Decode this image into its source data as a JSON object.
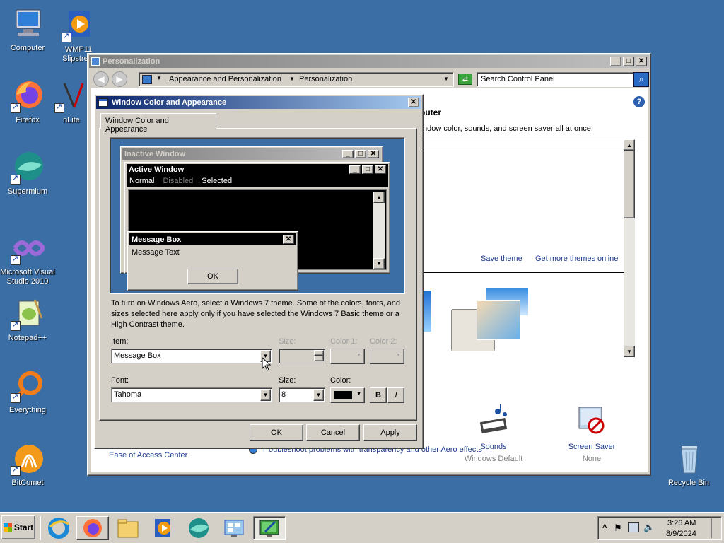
{
  "desktop": {
    "icons": [
      {
        "label": "Computer",
        "icon": "computer-icon"
      },
      {
        "label": "WMP11 Slipstre...",
        "icon": "wmp-icon"
      },
      {
        "label": "Firefox",
        "icon": "firefox-icon"
      },
      {
        "label": "nLite",
        "icon": "nlite-icon"
      },
      {
        "label": "Supermium",
        "icon": "supermium-icon"
      },
      {
        "label": "Microsoft Visual Studio 2010",
        "icon": "visual-studio-icon"
      },
      {
        "label": "Notepad++",
        "icon": "notepadpp-icon"
      },
      {
        "label": "Everything",
        "icon": "everything-icon"
      },
      {
        "label": "BitComet",
        "icon": "bitcomet-icon"
      },
      {
        "label": "Recycle Bin",
        "icon": "recycle-bin-icon"
      }
    ]
  },
  "personalization": {
    "title": "Personalization",
    "breadcrumb": [
      "Appearance and Personalization",
      "Personalization"
    ],
    "search_placeholder": "Search Control Panel",
    "heading_partial": "puter",
    "subtitle_partial": "ndow color, sounds, and screen saver all at once.",
    "save_theme": "Save theme",
    "get_more_themes": "Get more themes online",
    "sounds_label": "Sounds",
    "sounds_value": "Windows Default",
    "screensaver_label": "Screen Saver",
    "screensaver_value": "None",
    "ease_of_access": "Ease of Access Center",
    "troubleshoot": "Troubleshoot problems with transparency and other Aero effects"
  },
  "dialog": {
    "title": "Window Color and Appearance",
    "tab": "Window Color and Appearance",
    "preview": {
      "inactive_title": "Inactive Window",
      "active_title": "Active Window",
      "menu_normal": "Normal",
      "menu_disabled": "Disabled",
      "menu_selected": "Selected",
      "msgbox_title": "Message Box",
      "msgbox_text": "Message Text",
      "msgbox_ok": "OK"
    },
    "info_text": "To turn on Windows Aero, select a Windows 7 theme.  Some of the colors, fonts, and sizes selected here apply only if you have selected the Windows 7 Basic theme or a High Contrast theme.",
    "item_label": "Item:",
    "item_value": "Message Box",
    "size_label": "Size:",
    "color1_label": "Color 1:",
    "color2_label": "Color 2:",
    "font_label": "Font:",
    "font_value": "Tahoma",
    "font_size_label": "Size:",
    "font_size_value": "8",
    "font_color_label": "Color:",
    "bold_label": "B",
    "italic_label": "I",
    "ok": "OK",
    "cancel": "Cancel",
    "apply": "Apply"
  },
  "taskbar": {
    "start": "Start",
    "time": "3:26 AM",
    "date": "8/9/2024"
  },
  "colors": {
    "desktop": "#3a6ea5",
    "active_title": "#0a246a",
    "face": "#d4d0c8"
  }
}
